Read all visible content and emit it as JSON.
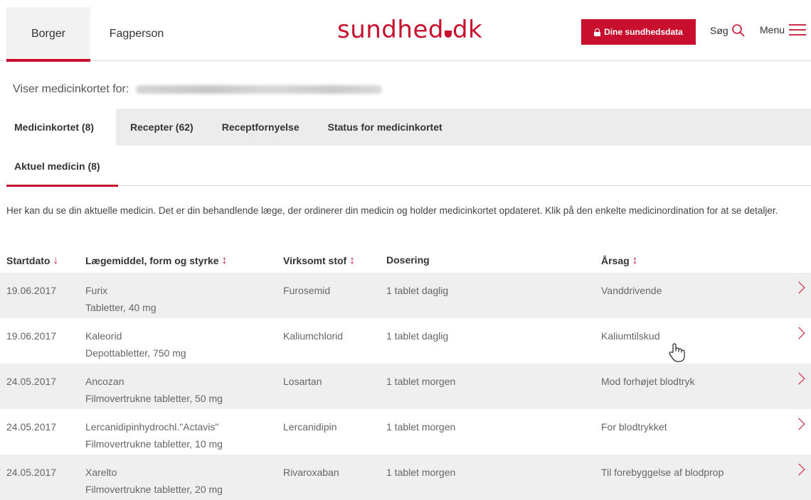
{
  "header": {
    "audience_tabs": [
      "Borger",
      "Fagperson"
    ],
    "logo_text_a": "sundhed",
    "logo_text_b": "dk",
    "data_button_label": "Dine sundhedsdata",
    "search_label": "Søg",
    "menu_label": "Menu",
    "accent_color": "#c8102e"
  },
  "patient": {
    "label": "Viser medicinkortet for:"
  },
  "main_tabs": [
    {
      "label": "Medicinkortet (8)",
      "active": true
    },
    {
      "label": "Recepter (62)",
      "active": false
    },
    {
      "label": "Receptfornyelse",
      "active": false
    },
    {
      "label": "Status for medicinkortet",
      "active": false
    }
  ],
  "sub_tabs": [
    {
      "label": "Aktuel medicin (8)",
      "active": true
    }
  ],
  "intro": "Her kan du se din aktuelle medicin. Det er din behandlende læge, der ordinerer din medicin og holder medicinkortet opdateret. Klik på den enkelte medicinordination for at se detaljer.",
  "table": {
    "columns": [
      {
        "label": "Startdato",
        "sort_icon": "↓"
      },
      {
        "label": "Lægemiddel, form og styrke",
        "sort_icon": "↕"
      },
      {
        "label": "Virksomt stof",
        "sort_icon": "↕"
      },
      {
        "label": "Dosering",
        "sort_icon": ""
      },
      {
        "label": "Årsag",
        "sort_icon": "↕"
      }
    ],
    "rows": [
      {
        "date": "19.06.2017",
        "drug": "Furix",
        "form": "Tabletter, 40 mg",
        "substance": "Furosemid",
        "dosage": "1 tablet daglig",
        "reason": "Vanddrivende"
      },
      {
        "date": "19.06.2017",
        "drug": "Kaleorid",
        "form": "Depottabletter, 750 mg",
        "substance": "Kaliumchlorid",
        "dosage": "1 tablet daglig",
        "reason": "Kaliumtilskud"
      },
      {
        "date": "24.05.2017",
        "drug": "Ancozan",
        "form": "Filmovertrukne tabletter, 50 mg",
        "substance": "Losartan",
        "dosage": "1 tablet morgen",
        "reason": "Mod forhøjet blodtryk"
      },
      {
        "date": "24.05.2017",
        "drug": "Lercanidipinhydrochl.\"Actavis\"",
        "form": "Filmovertrukne tabletter, 10 mg",
        "substance": "Lercanidipin",
        "dosage": "1 tablet morgen",
        "reason": "For blodtrykket"
      },
      {
        "date": "24.05.2017",
        "drug": "Xarelto",
        "form": "Filmovertrukne tabletter, 20 mg",
        "substance": "Rivaroxaban",
        "dosage": "1 tablet morgen",
        "reason": "Til forebyggelse af blodprop"
      }
    ]
  }
}
